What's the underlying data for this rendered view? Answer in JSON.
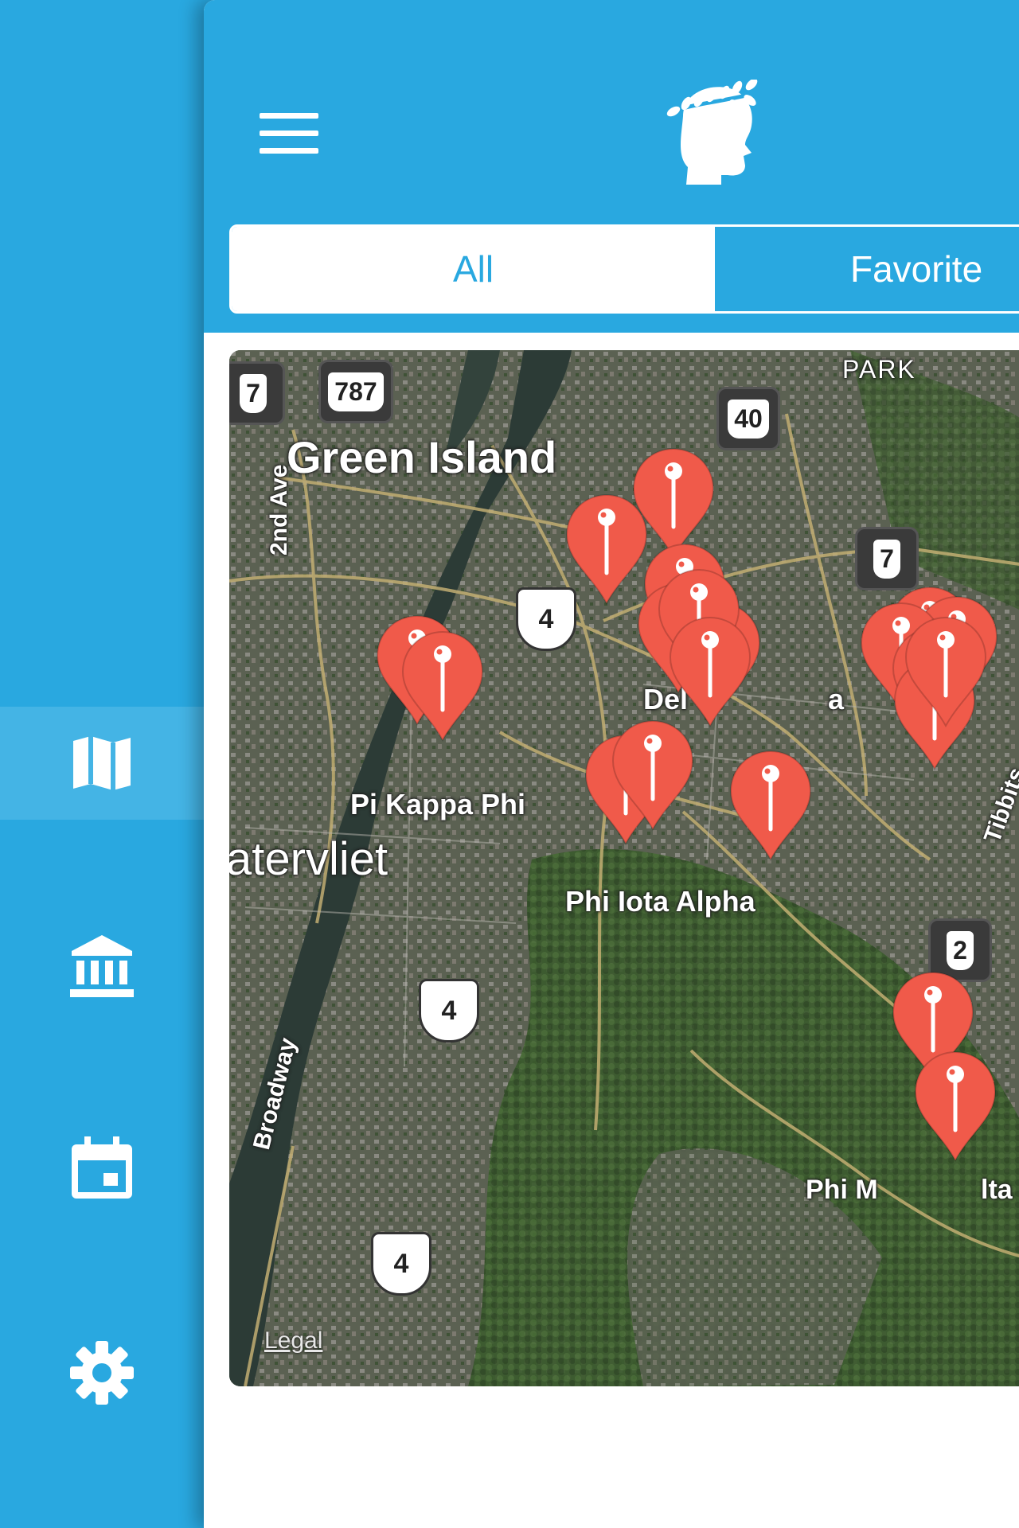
{
  "rail": {
    "items": [
      {
        "icon": "map-icon",
        "active": true
      },
      {
        "icon": "institution-icon",
        "active": false
      },
      {
        "icon": "calendar-icon",
        "active": false
      },
      {
        "icon": "gear-icon",
        "active": false
      }
    ]
  },
  "header": {
    "menu_icon": "hamburger-icon",
    "logo_icon": "laurel-head-icon"
  },
  "tabs": {
    "all_label": "All",
    "favorites_label": "Favorite"
  },
  "map": {
    "labels": {
      "green_island": "Green Island",
      "park": "PARK",
      "second_ave": "2nd Ave",
      "pi_kappa_phi": "Pi Kappa Phi",
      "watervliet": "atervliet",
      "phi_iota_alpha": "Phi Iota Alpha",
      "delta": "Del",
      "delta_tail": "a",
      "tibbits": "Tibbits",
      "broadway": "Broadway",
      "phi_mu_delta_a": "Phi M",
      "phi_mu_delta_b": "lta"
    },
    "shields": {
      "ny7_a": "7",
      "ny787": "787",
      "ny40": "40",
      "ny7_b": "7",
      "ny2": "2",
      "us4_a": "4",
      "us4_b": "4",
      "us4_c": "4"
    },
    "legal": "Legal",
    "pin_color": "#f05a4a",
    "pin_count": 20
  }
}
